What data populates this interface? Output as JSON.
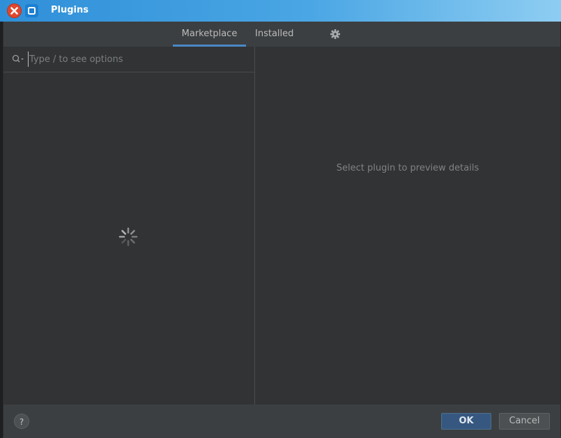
{
  "window": {
    "title": "Plugins"
  },
  "tabs": [
    {
      "label": "Marketplace",
      "active": true
    },
    {
      "label": "Installed",
      "active": false
    }
  ],
  "search": {
    "placeholder": "Type / to see options",
    "value": ""
  },
  "details": {
    "empty_message": "Select plugin to preview details"
  },
  "footer": {
    "help_label": "?",
    "ok_label": "OK",
    "cancel_label": "Cancel"
  },
  "icons": {
    "close": "close-icon",
    "maximize": "maximize-icon",
    "settings": "gear-icon",
    "search": "search-icon",
    "loading": "loading-spinner-icon"
  },
  "colors": {
    "titlebar": "#2f8fd8",
    "close_button": "#e0472f",
    "accent": "#4a88c7",
    "panel_bg": "#313335",
    "ok_button": "#365880"
  }
}
